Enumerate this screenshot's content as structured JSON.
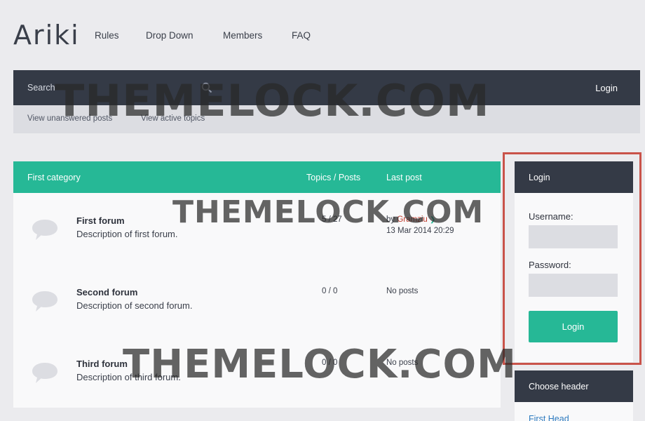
{
  "header": {
    "logo": "Ariki",
    "nav": [
      "Rules",
      "Drop Down",
      "Members",
      "FAQ"
    ]
  },
  "searchbar": {
    "label": "Search",
    "login": "Login",
    "icon": "search-icon"
  },
  "subnav": [
    "View unanswered posts",
    "View active topics"
  ],
  "forum_table": {
    "headers": {
      "category": "First category",
      "topics_posts": "Topics / Posts",
      "last_post": "Last post"
    },
    "rows": [
      {
        "title": "First forum",
        "description": "Description of first forum.",
        "count": "5 / 27",
        "last_post_by": "by",
        "last_post_user": "Gramziu",
        "last_post_date": "13 Mar 2014 20:29"
      },
      {
        "title": "Second forum",
        "description": "Description of second forum.",
        "count": "0 / 0",
        "last_post_text": "No posts"
      },
      {
        "title": "Third forum",
        "description": "Description of third forum.",
        "count": "0 / 0",
        "last_post_text": "No posts"
      }
    ]
  },
  "login_panel": {
    "title": "Login",
    "username_label": "Username:",
    "password_label": "Password:",
    "button": "Login"
  },
  "header_panel": {
    "title": "Choose header",
    "first_item": "First Head"
  },
  "watermark": {
    "text": "THEMELOCK.COM"
  },
  "colors": {
    "accent": "#26b896",
    "dark": "#343a46",
    "highlight": "#c9534a",
    "background": "#ebebee"
  }
}
